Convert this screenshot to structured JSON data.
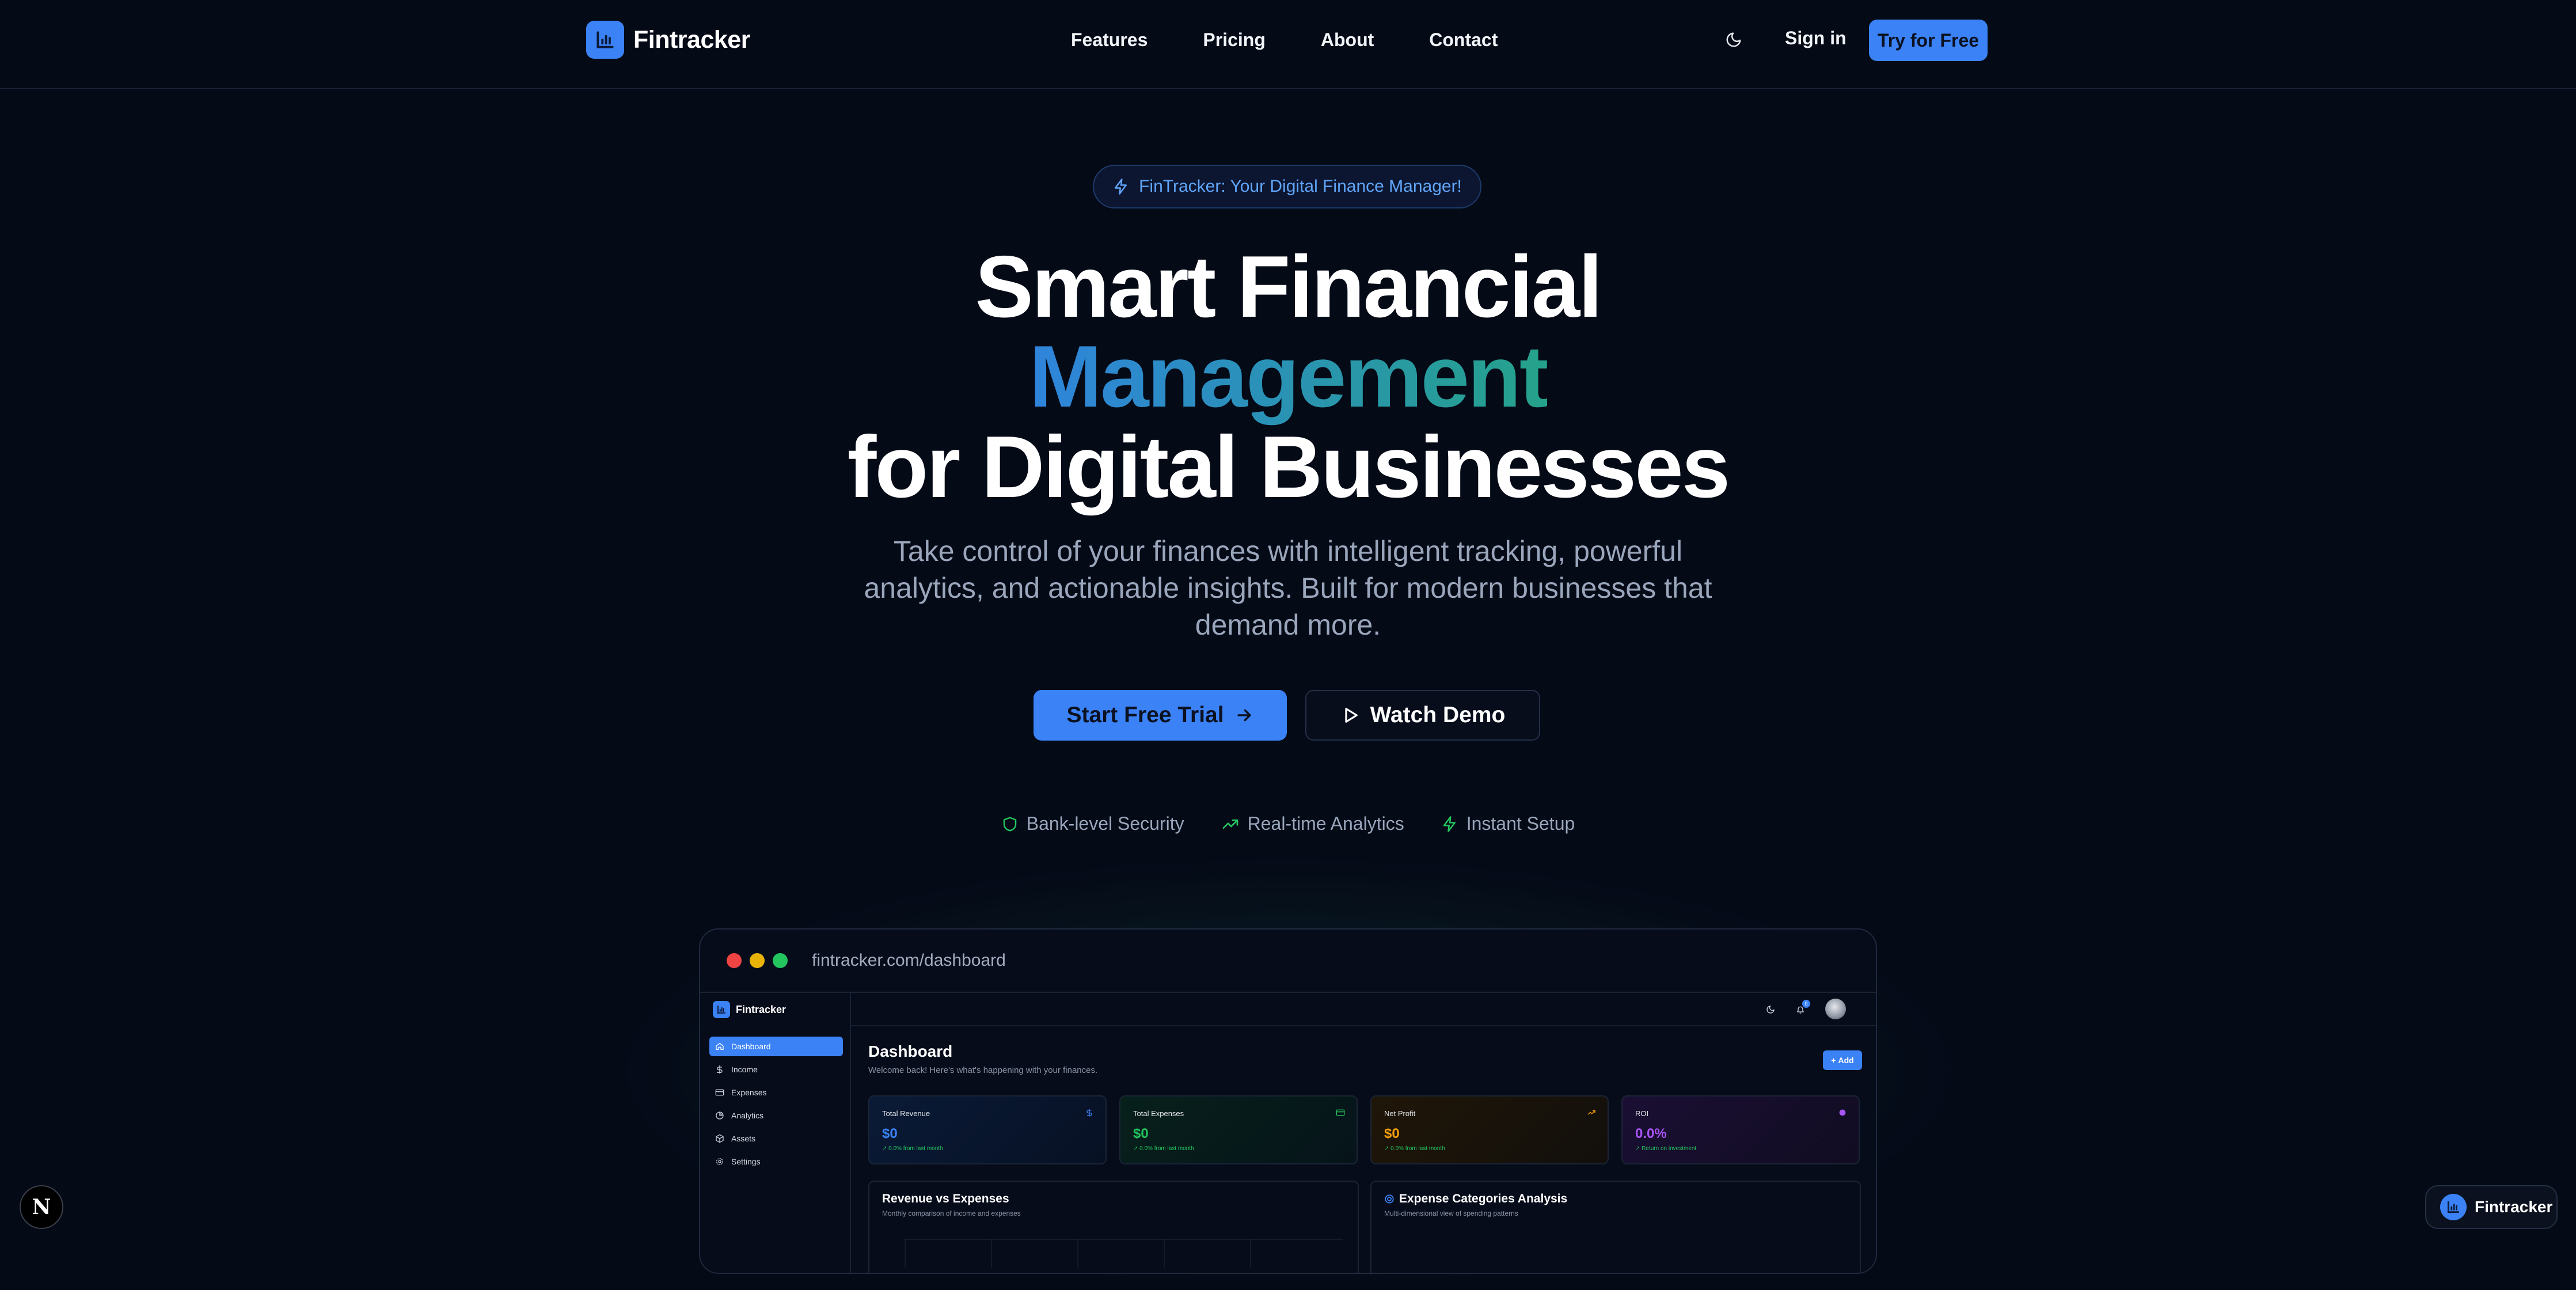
{
  "nav": {
    "brand": "Fintracker",
    "links": [
      "Features",
      "Pricing",
      "About",
      "Contact"
    ],
    "sign_in": "Sign in",
    "try_free": "Try for Free"
  },
  "hero": {
    "badge": "FinTracker: Your Digital Finance Manager!",
    "title_line1": "Smart Financial",
    "title_line2": "Management",
    "title_line3": "for Digital Businesses",
    "subtitle": "Take control of your finances with intelligent tracking, powerful analytics, and actionable insights. Built for modern businesses that demand more.",
    "cta_primary": "Start Free Trial",
    "cta_secondary": "Watch Demo",
    "features": [
      "Bank-level Security",
      "Real-time Analytics",
      "Instant Setup"
    ]
  },
  "preview": {
    "url": "fintracker.com/dashboard",
    "sidebar": {
      "brand": "Fintracker",
      "items": [
        "Dashboard",
        "Income",
        "Expenses",
        "Analytics",
        "Assets",
        "Settings"
      ]
    },
    "notification_count": "0",
    "header": {
      "title": "Dashboard",
      "subtitle": "Welcome back! Here's what's happening with your finances.",
      "add_label": "Add"
    },
    "stats": [
      {
        "label": "Total Revenue",
        "value": "$0",
        "sub": "↗ 0.0% from last month",
        "color": "#3b82f6"
      },
      {
        "label": "Total Expenses",
        "value": "$0",
        "sub": "↗ 0.0% from last month",
        "color": "#22c55e"
      },
      {
        "label": "Net Profit",
        "value": "$0",
        "sub": "↗ 0.0% from last month",
        "color": "#f59e0b"
      },
      {
        "label": "ROI",
        "value": "0.0%",
        "sub": "↗ Return on investment",
        "color": "#a855f7"
      }
    ],
    "panels": [
      {
        "title": "Revenue vs Expenses",
        "subtitle": "Monthly comparison of income and expenses"
      },
      {
        "title": "Expense Categories Analysis",
        "subtitle": "Multi-dimensional view of spending patterns"
      }
    ]
  },
  "corner": {
    "n_badge": "N",
    "chip": "Fintracker"
  },
  "colors": {
    "background": "#050a17",
    "accent": "#3b82f6",
    "muted_text": "#9aa6bb",
    "gradient_start": "#2f84dc",
    "gradient_end": "#25a28a",
    "success": "#22c55e"
  },
  "icons": {
    "logo": "bar-chart-icon",
    "theme": "moon-icon",
    "badge": "lightning-icon",
    "cta_primary": "arrow-right-icon",
    "cta_secondary": "play-icon",
    "features": [
      "shield-icon",
      "trending-up-icon",
      "lightning-icon"
    ]
  }
}
